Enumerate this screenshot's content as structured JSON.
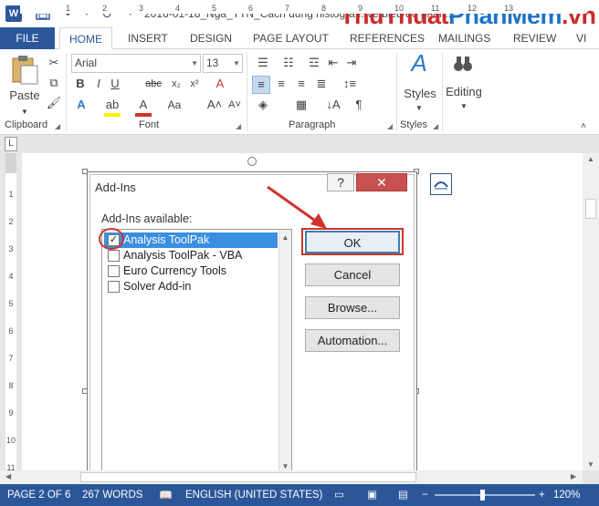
{
  "title_bar": {
    "document_title": "2016-01-18_Nga_TTN_Cách dùng histogra... vẽ biểu đồ phân...",
    "watermark_part1": "ThuThuat",
    "watermark_part2": "PhanMem",
    "watermark_part3": ".vn"
  },
  "tabs": [
    "FILE",
    "HOME",
    "INSERT",
    "DESIGN",
    "PAGE LAYOUT",
    "REFERENCES",
    "MAILINGS",
    "REVIEW",
    "VI"
  ],
  "ribbon": {
    "clipboard": {
      "paste_label": "Paste",
      "group_label": "Clipboard"
    },
    "font": {
      "font_name": "Arial",
      "font_size": "13",
      "group_label": "Font"
    },
    "paragraph": {
      "group_label": "Paragraph"
    },
    "styles": {
      "styles_label": "Styles",
      "group_label": "Styles"
    },
    "editing": {
      "editing_label": "Editing"
    }
  },
  "ruler_numbers": [
    "1",
    "2",
    "3",
    "4",
    "5",
    "6",
    "7",
    "8",
    "9",
    "10",
    "11",
    "12",
    "13"
  ],
  "vruler_numbers": [
    "1",
    "2",
    "3",
    "4",
    "5",
    "6",
    "7",
    "8",
    "9",
    "10",
    "11"
  ],
  "dialog": {
    "title": "Add-Ins",
    "help_glyph": "?",
    "close_glyph": "✕",
    "list_label": "Add-Ins available:",
    "items": [
      {
        "label": "Analysis ToolPak",
        "checked": true
      },
      {
        "label": "Analysis ToolPak - VBA",
        "checked": false
      },
      {
        "label": "Euro Currency Tools",
        "checked": false
      },
      {
        "label": "Solver Add-in",
        "checked": false
      }
    ],
    "buttons": {
      "ok": "OK",
      "cancel": "Cancel",
      "browse": "Browse...",
      "automation": "Automation..."
    },
    "annotation_color": "#d0342c"
  },
  "status_bar": {
    "page": "PAGE 2 OF 6",
    "words": "267 WORDS",
    "language": "ENGLISH (UNITED STATES)",
    "zoom": "120%"
  },
  "colors": {
    "accent": "#2b579a",
    "selection": "#3a8fe0",
    "close_button": "#c75050"
  }
}
